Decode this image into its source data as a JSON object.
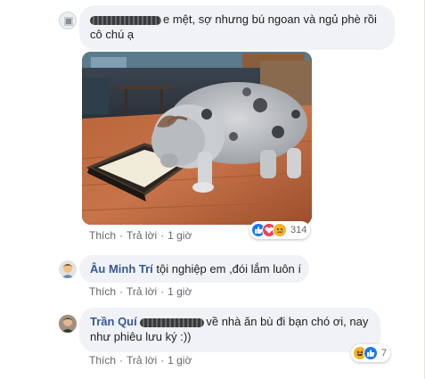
{
  "comments": [
    {
      "author_redacted": true,
      "text_line1": "e mệt, sợ nhưng bú ngoan và ngủ phè rồi",
      "text_line2": "cô chú ạ",
      "actions": {
        "like": "Thích",
        "reply": "Trả lời",
        "sep": "·",
        "time": "1 giờ"
      },
      "reaction_count": "314"
    },
    {
      "author": "Âu Minh Trí",
      "text": "tội nghiệp em ,đói lắm luôn í",
      "actions": {
        "like": "Thích",
        "reply": "Trả lời",
        "sep": "·",
        "time": "1 giờ"
      }
    },
    {
      "author": "Trần Quí",
      "text_line1": "về nhà ăn bù đi bạn chó ơi, nay",
      "text_line2": "như phiêu lưu ký :))",
      "actions": {
        "like": "Thích",
        "reply": "Trả lời",
        "sep": "·",
        "time": "1 giờ"
      },
      "reaction_count": "7"
    }
  ],
  "colors": {
    "bubble": "#f0f2f5",
    "name": "#385898",
    "like": "#1877f2",
    "love": "#f33e58",
    "haha": "#f7b125"
  },
  "icons": [
    "like-reaction-icon",
    "love-reaction-icon",
    "sad-reaction-icon",
    "haha-reaction-icon"
  ]
}
